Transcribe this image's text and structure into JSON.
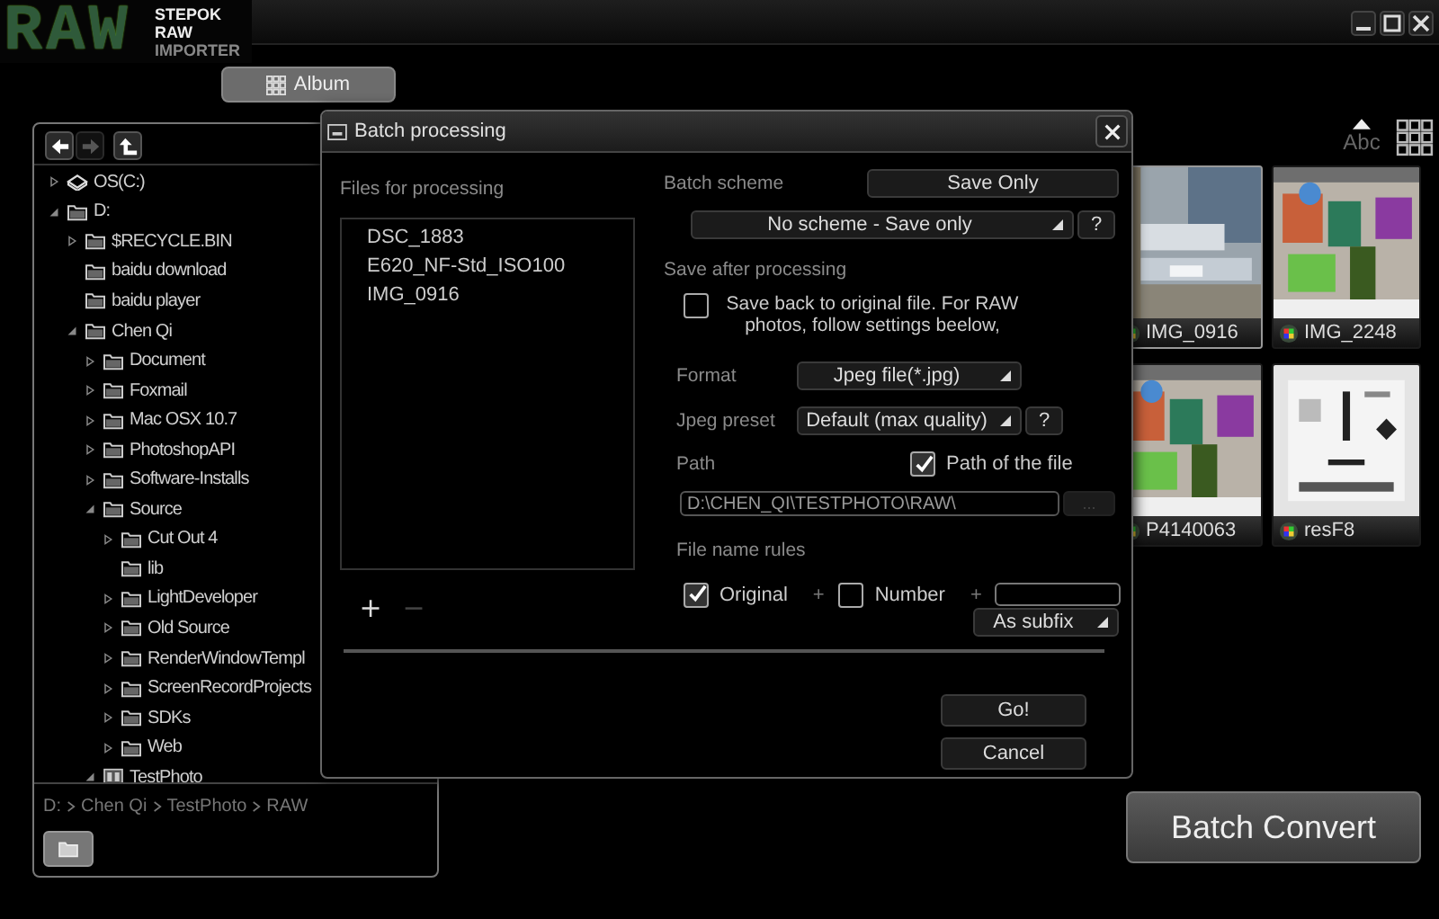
{
  "app": {
    "logo_mark": "RAW",
    "logo_lines": [
      "STEPOK",
      "RAW",
      "IMPORTER"
    ]
  },
  "album_button": "Album",
  "browser": {
    "nav": [
      {
        "kind": "back",
        "disabled": false
      },
      {
        "kind": "forward",
        "disabled": true
      },
      {
        "kind": "up",
        "disabled": false
      }
    ],
    "tree": [
      {
        "label": "OS(C:)",
        "kind": "drive",
        "expanded": false
      },
      {
        "label": "D:",
        "kind": "folder",
        "expanded": true,
        "children": [
          {
            "label": "$RECYCLE.BIN",
            "kind": "folder",
            "expanded": false
          },
          {
            "label": "baidu download",
            "kind": "folder"
          },
          {
            "label": "baidu player",
            "kind": "folder"
          },
          {
            "label": "Chen Qi",
            "kind": "folder",
            "expanded": true,
            "children": [
              {
                "label": "Document",
                "kind": "folder",
                "expanded": false
              },
              {
                "label": "Foxmail",
                "kind": "folder",
                "expanded": false
              },
              {
                "label": "Mac OSX 10.7",
                "kind": "folder",
                "expanded": false
              },
              {
                "label": "PhotoshopAPI",
                "kind": "folder",
                "expanded": false
              },
              {
                "label": "Software-Installs",
                "kind": "folder",
                "expanded": false
              },
              {
                "label": "Source",
                "kind": "folder",
                "expanded": true,
                "children": [
                  {
                    "label": "Cut Out 4",
                    "kind": "folder",
                    "expanded": false
                  },
                  {
                    "label": "lib",
                    "kind": "folder"
                  },
                  {
                    "label": "LightDeveloper",
                    "kind": "folder",
                    "expanded": false
                  },
                  {
                    "label": "Old Source",
                    "kind": "folder",
                    "expanded": false
                  },
                  {
                    "label": "RenderWindowTempl",
                    "kind": "folder",
                    "expanded": false
                  },
                  {
                    "label": "ScreenRecordProjects",
                    "kind": "folder",
                    "expanded": false
                  },
                  {
                    "label": "SDKs",
                    "kind": "folder",
                    "expanded": false
                  },
                  {
                    "label": "Web",
                    "kind": "folder",
                    "expanded": false
                  }
                ]
              },
              {
                "label": "TestPhoto",
                "kind": "photo-folder",
                "expanded": true
              }
            ]
          }
        ]
      }
    ],
    "breadcrumb": [
      "D:",
      "Chen Qi",
      "TestPhoto",
      "RAW"
    ]
  },
  "gallery": {
    "sort_label": "Abc",
    "thumbnails": [
      {
        "name": "IMG_0916",
        "selected": true
      },
      {
        "name": "IMG_2248",
        "selected": false
      },
      {
        "name": "P4140063",
        "selected": false
      },
      {
        "name": "resF8",
        "selected": false
      }
    ]
  },
  "batch_convert": "Batch Convert",
  "dialog": {
    "title": "Batch processing",
    "files_label": "Files for processing",
    "files": [
      "DSC_1883",
      "E620_NF-Std_ISO100",
      "IMG_0916"
    ],
    "add": {
      "label": "+",
      "disabled": false
    },
    "remove": {
      "label": "−",
      "disabled": true
    },
    "scheme_label": "Batch scheme",
    "scheme_button": "Save Only",
    "scheme_select": "No scheme - Save only",
    "scheme_help": "?",
    "save_label": "Save after processing",
    "save_back": {
      "label": "Save back to original file. For RAW photos, follow settings beelow,",
      "checked": false
    },
    "format": {
      "label": "Format",
      "value": "Jpeg file(*.jpg)"
    },
    "preset": {
      "label": "Jpeg preset",
      "value": "Default (max quality)",
      "help": "?"
    },
    "path": {
      "label": "Path",
      "checkbox": {
        "label": "Path of the file",
        "checked": true
      },
      "value": "D:\\CHEN_QI\\TESTPHOTO\\RAW\\",
      "disabled": true,
      "browse": "..."
    },
    "name_rules": {
      "label": "File name rules",
      "parts": [
        {
          "kind": "checkbox",
          "label": "Original",
          "checked": true
        },
        {
          "kind": "plus",
          "label": "+"
        },
        {
          "kind": "checkbox",
          "label": "Number",
          "checked": false
        },
        {
          "kind": "plus",
          "label": "+"
        },
        {
          "kind": "field"
        }
      ],
      "position": "As subfix"
    },
    "go": "Go!",
    "cancel": "Cancel"
  }
}
